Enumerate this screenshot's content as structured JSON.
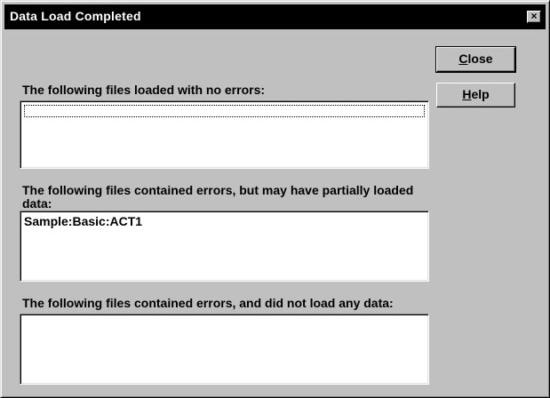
{
  "window": {
    "title": "Data Load Completed",
    "close_glyph": "×"
  },
  "buttons": {
    "close": {
      "accel": "C",
      "rest": "lose"
    },
    "help": {
      "accel": "H",
      "rest": "elp"
    }
  },
  "sections": [
    {
      "label": "The following files loaded with no errors:",
      "items": []
    },
    {
      "label": "The following files contained errors, but may have partially loaded data:",
      "items": [
        "Sample:Basic:ACT1"
      ]
    },
    {
      "label": "The following files contained errors, and did not load any data:",
      "items": []
    }
  ],
  "colors": {
    "face": "#c0c0c0",
    "titlebar": "#000000",
    "list_bg": "#ffffff"
  }
}
